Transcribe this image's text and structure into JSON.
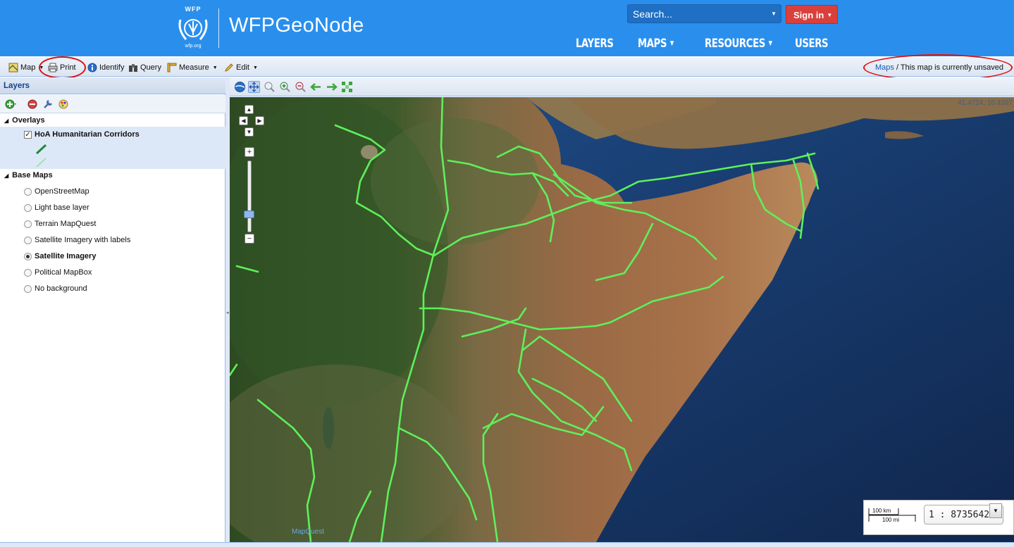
{
  "header": {
    "logo_top": "WFP",
    "logo_bottom": "wfp.org",
    "brand": "WFPGeoNode",
    "search_placeholder": "Search...",
    "signin_label": "Sign in",
    "nav": [
      {
        "label": "LAYERS"
      },
      {
        "label": "MAPS"
      },
      {
        "label": "RESOURCES"
      },
      {
        "label": "USERS"
      }
    ]
  },
  "toolbar": {
    "items": [
      "Map",
      "Print",
      "Identify",
      "Query",
      "Measure",
      "Edit"
    ],
    "breadcrumb_link": "Maps",
    "breadcrumb_text": " / This map is currently unsaved"
  },
  "layers_panel": {
    "title": "Layers",
    "overlays_label": "Overlays",
    "overlay_layer": "HoA Humanitarian Corridors",
    "basemaps_label": "Base Maps",
    "basemaps": [
      {
        "label": "OpenStreetMap",
        "selected": false
      },
      {
        "label": "Light base layer",
        "selected": false
      },
      {
        "label": "Terrain MapQuest",
        "selected": false
      },
      {
        "label": "Satellite Imagery with labels",
        "selected": false
      },
      {
        "label": "Satellite Imagery",
        "selected": true
      },
      {
        "label": "Political MapBox",
        "selected": false
      },
      {
        "label": "No background",
        "selected": false
      }
    ]
  },
  "map": {
    "coordinates": "41.4724, 10.4397",
    "scale_km": "100 km",
    "scale_mi": "100 mi",
    "scale_ratio": "1 : 8735642",
    "attribution": "MapQuest"
  },
  "colors": {
    "header_blue": "#2a8fec",
    "signin_red": "#d9403c",
    "corridor_green": "#5ef05a",
    "annotation_red": "#dd1111"
  }
}
